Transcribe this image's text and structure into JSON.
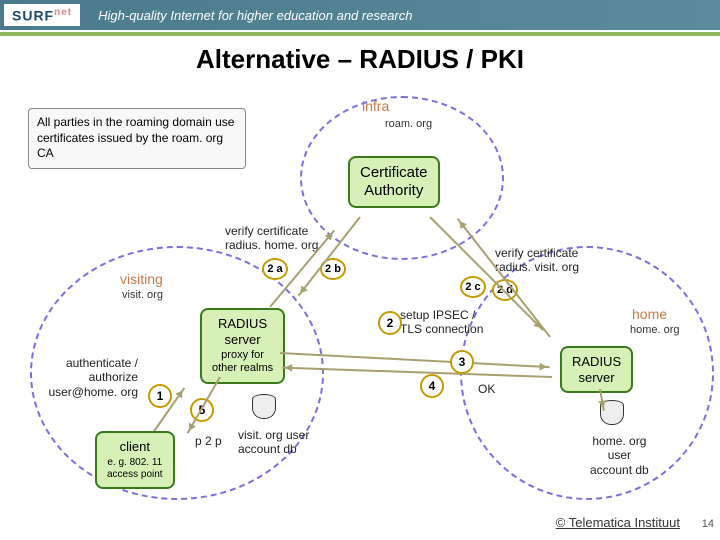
{
  "header": {
    "logo_main": "SURF",
    "logo_sup": "net",
    "tagline": "High-quality Internet for higher education and research"
  },
  "title": "Alternative  –  RADIUS / PKI",
  "note_box": "All parties in the roaming domain use certificates issued by the roam. org CA",
  "domains": {
    "infra": {
      "label": "infra",
      "sub": "roam. org"
    },
    "visiting": {
      "label": "visiting",
      "sub": "visit. org"
    },
    "home": {
      "label": "home",
      "sub": "home. org"
    }
  },
  "boxes": {
    "ca": "Certificate\nAuthority",
    "radius_visit": "RADIUS\nserver",
    "radius_visit_sub": "proxy  for\nother realms",
    "radius_home": "RADIUS\nserver",
    "client": "client",
    "client_sub": "e. g. 802. 11\naccess point"
  },
  "labels": {
    "verify_home": "verify certificate\nradius. home. org",
    "verify_visit": "verify certificate\nradius. visit. org",
    "setup_ipsec": "setup IPSEC /\nTLS connection",
    "auth": "authenticate /\nauthorize\nuser@home. org",
    "ok": "OK",
    "p2p": "p 2 p",
    "db_visit": "visit. org user\naccount db",
    "db_home": "home. org\nuser\naccount db"
  },
  "steps": {
    "s1": "1",
    "s2a": "2 a",
    "s2b": "2 b",
    "s2c": "2 c",
    "s2d": "2 d",
    "s2": "2",
    "s3": "3",
    "s4": "4",
    "s5": "5"
  },
  "footer": "© Telematica Instituut",
  "pagenum": "14"
}
